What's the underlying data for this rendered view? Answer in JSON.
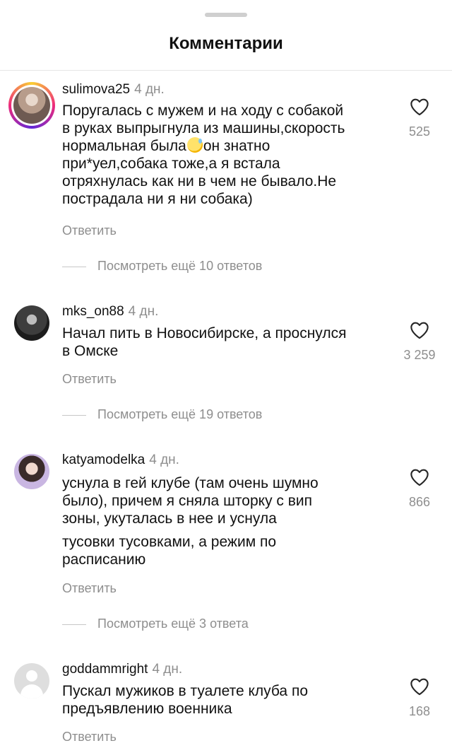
{
  "sheet": {
    "title": "Комментарии"
  },
  "comments": [
    {
      "username": "sulimova25",
      "time": "4 дн.",
      "lines": [
        "Поругалась с мужем и на ходу с собакой",
        "в руках выпрыгнула из машины,скорость",
        "нормальная была",
        "при*уел,собака тоже,а я встала",
        "отряхнулась как ни в чем не бывало.Не",
        "пострадала ни я ни собака)"
      ],
      "line3_after_emoji": "он знатно",
      "emoji": "grinning-sweat-emoji",
      "likes": "525",
      "reply_label": "Ответить",
      "view_more": "Посмотреть ещё 10 ответов"
    },
    {
      "username": "mks_on88",
      "time": "4 дн.",
      "lines": [
        "Начал пить в Новосибирске, а проснулся",
        "в Омске"
      ],
      "likes": "3 259",
      "reply_label": "Ответить",
      "view_more": "Посмотреть ещё 19 ответов"
    },
    {
      "username": "katyamodelka",
      "time": "4 дн.",
      "lines": [
        "уснула в гей клубе (там очень шумно",
        "было), причем я сняла шторку с вип",
        "зоны, укуталась в нее и уснула",
        "тусовки тусовками, а режим по",
        "расписанию"
      ],
      "likes": "866",
      "reply_label": "Ответить",
      "view_more": "Посмотреть ещё 3 ответа"
    },
    {
      "username": "goddammright",
      "time": "4 дн.",
      "lines": [
        "Пускал мужиков в туалете клуба по",
        "предъявлению военника"
      ],
      "likes": "168",
      "reply_label": "Ответить"
    }
  ],
  "colors": {
    "text": "#111111",
    "secondary": "#8e8e8e",
    "divider": "#e6e6e6"
  },
  "icons": {
    "like": "heart-outline-icon",
    "handle": "drag-handle"
  }
}
